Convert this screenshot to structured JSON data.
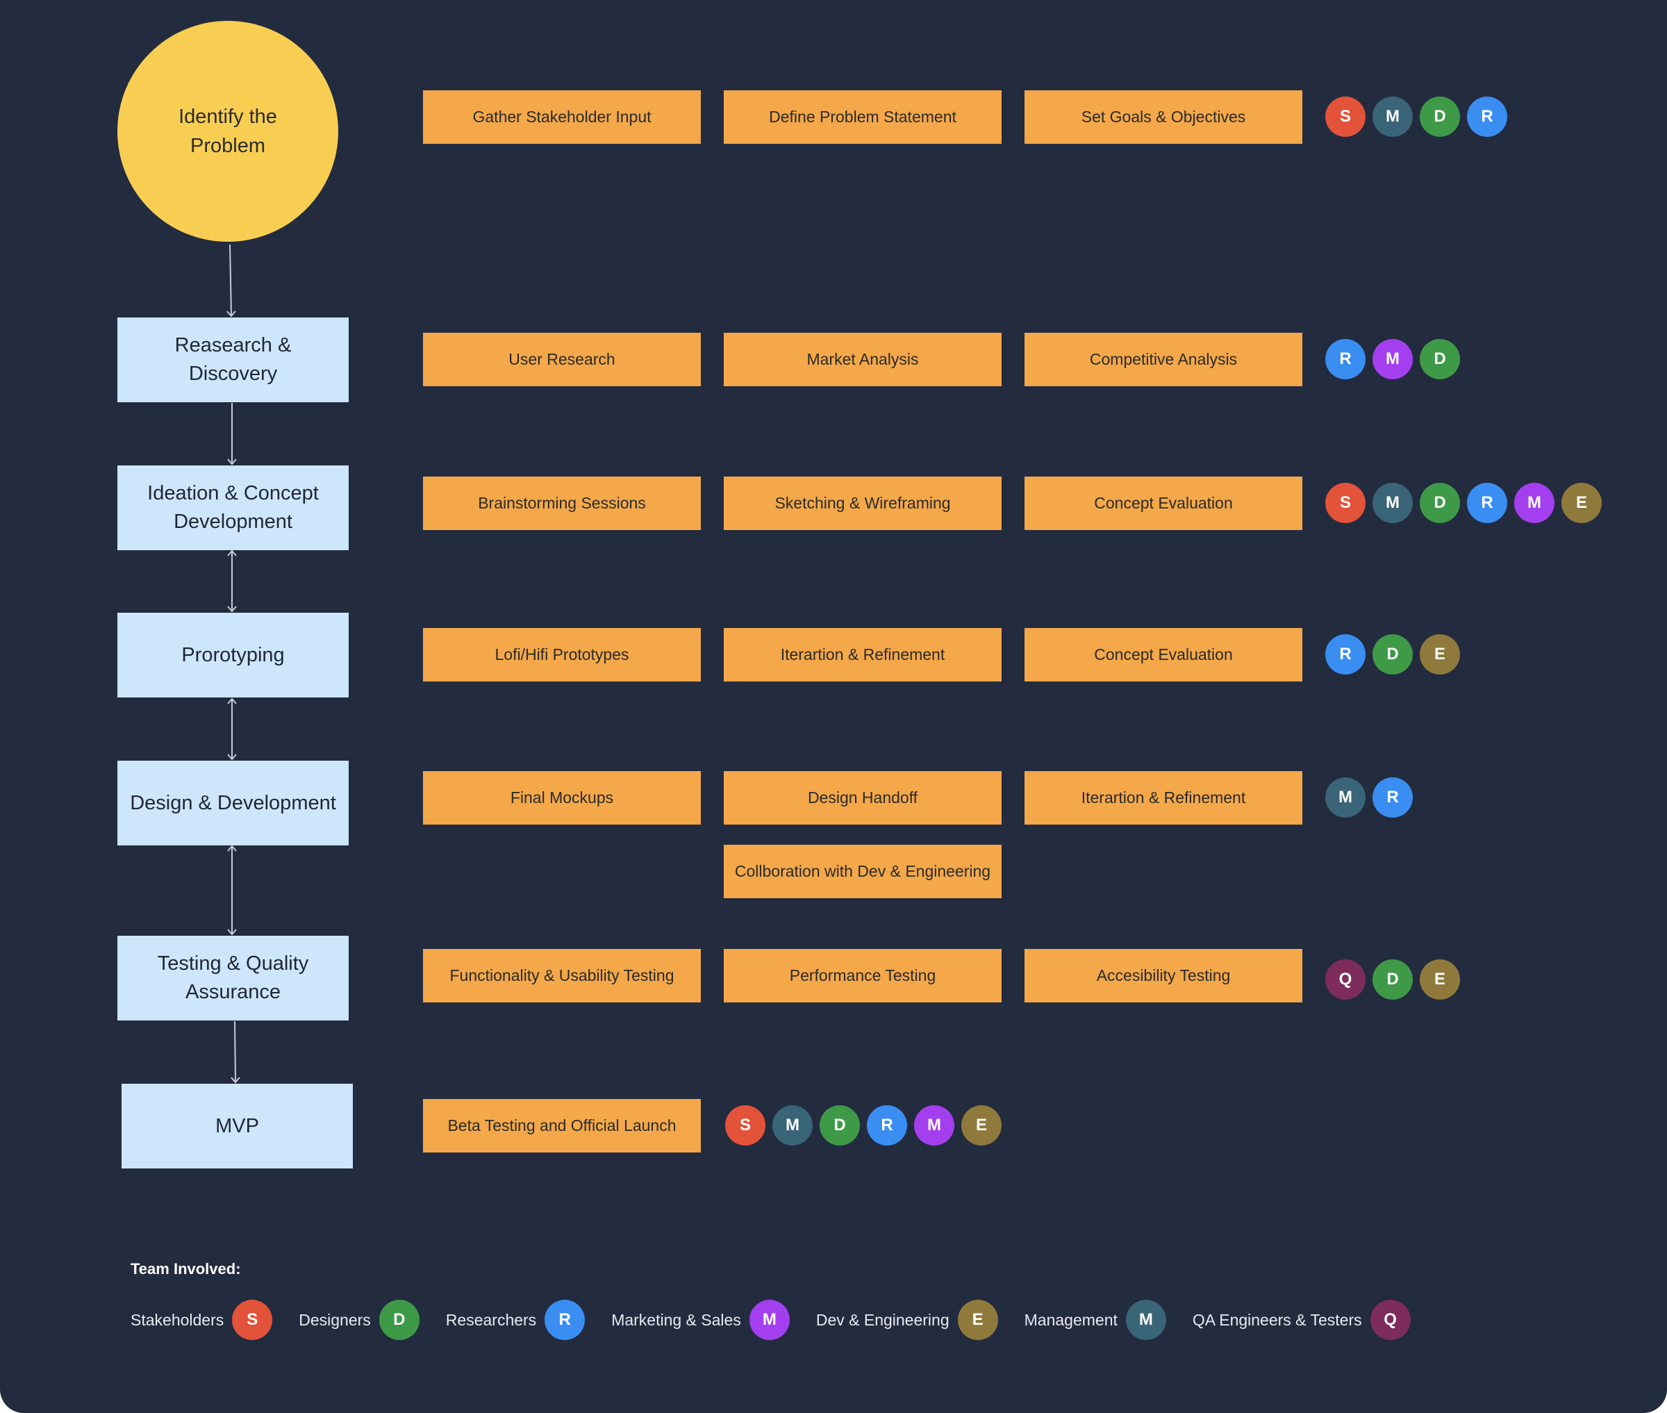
{
  "colors": {
    "background": "#232b3f",
    "circle": "#f8ce52",
    "stage": "#cde6fb",
    "task": "#f4a849",
    "connector": "#c8ccd4"
  },
  "roles": {
    "S": {
      "letter": "S",
      "label": "Stakeholders",
      "color": "#e2533a"
    },
    "D": {
      "letter": "D",
      "label": "Designers",
      "color": "#3e9a47"
    },
    "R": {
      "letter": "R",
      "label": "Researchers",
      "color": "#3a8ef2"
    },
    "MS": {
      "letter": "M",
      "label": "Marketing & Sales",
      "color": "#a43ff0"
    },
    "E": {
      "letter": "E",
      "label": "Dev & Engineering",
      "color": "#8f7a3c"
    },
    "MG": {
      "letter": "M",
      "label": "Management",
      "color": "#3a6478"
    },
    "Q": {
      "letter": "Q",
      "label": "QA Engineers & Testers",
      "color": "#7d2c5c"
    }
  },
  "stages": [
    {
      "title": "Identify the Problem",
      "tasks": [
        "Gather Stakeholder Input",
        "Define Problem Statement",
        "Set Goals & Objectives"
      ],
      "team": [
        "S",
        "MG",
        "D",
        "R"
      ]
    },
    {
      "title": "Reasearch & Discovery",
      "tasks": [
        "User Research",
        "Market Analysis",
        "Competitive Analysis"
      ],
      "team": [
        "R",
        "MS",
        "D"
      ]
    },
    {
      "title": "Ideation & Concept Development",
      "tasks": [
        "Brainstorming Sessions",
        "Sketching & Wireframing",
        "Concept Evaluation"
      ],
      "team": [
        "S",
        "MG",
        "D",
        "R",
        "MS",
        "E"
      ]
    },
    {
      "title": "Prorotyping",
      "tasks": [
        "Lofi/Hifi Prototypes",
        "Iterartion & Refinement",
        "Concept Evaluation"
      ],
      "team": [
        "R",
        "D",
        "E"
      ]
    },
    {
      "title": "Design & Development",
      "tasks": [
        "Final Mockups",
        "Design Handoff",
        "Iterartion & Refinement"
      ],
      "extra_task": "Collboration with Dev & Engineering",
      "team": [
        "MG",
        "R"
      ]
    },
    {
      "title": "Testing & Quality Assurance",
      "tasks": [
        "Functionality & Usability Testing",
        "Performance Testing",
        "Accesibility Testing"
      ],
      "team": [
        "Q",
        "D",
        "E"
      ]
    },
    {
      "title": "MVP",
      "tasks": [
        "Beta Testing and Official Launch"
      ],
      "team": [
        "S",
        "MG",
        "D",
        "R",
        "MS",
        "E"
      ]
    }
  ],
  "legend": {
    "title": "Team Involved:",
    "order": [
      "S",
      "D",
      "R",
      "MS",
      "E",
      "MG",
      "Q"
    ]
  }
}
